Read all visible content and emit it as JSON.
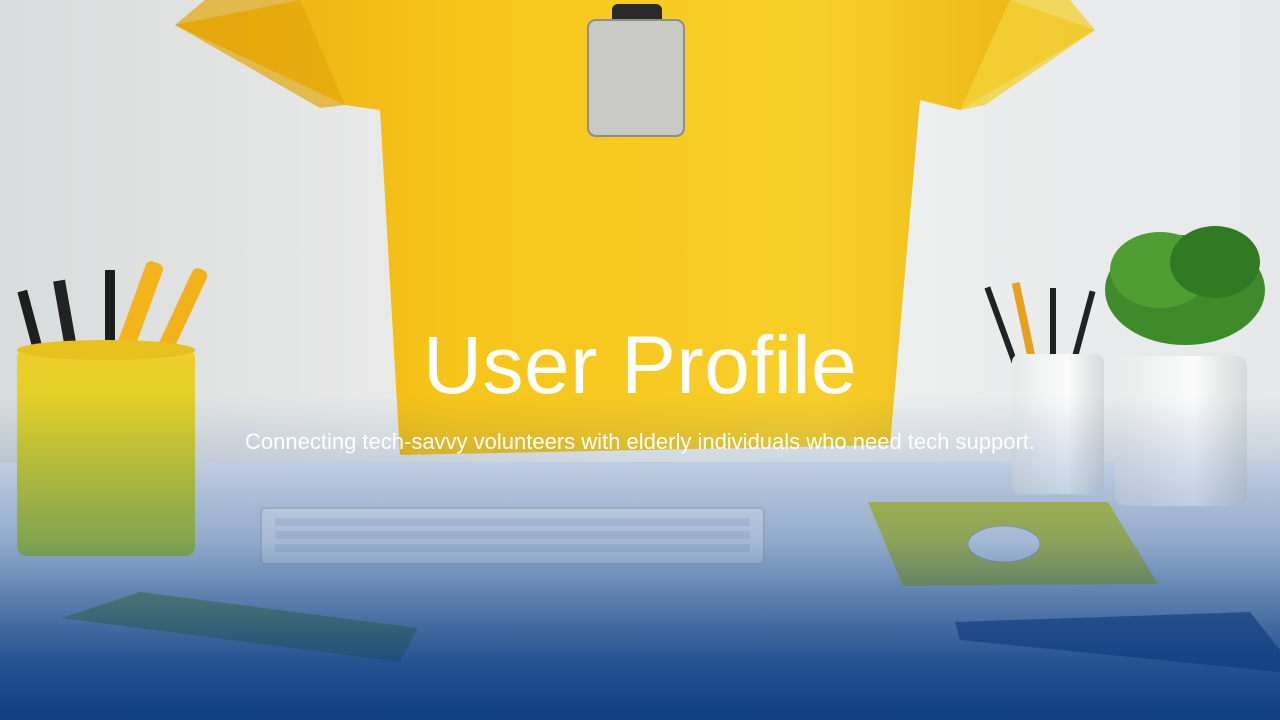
{
  "hero": {
    "title": "User Profile",
    "subtitle": "Connecting tech-savvy volunteers with elderly individuals who need tech support."
  },
  "background_image": {
    "subject": "desk-scene-with-yellow-tshirt",
    "icons": [
      "tshirt-icon",
      "id-badge-icon",
      "pencil-cup-icon",
      "keyboard-icon",
      "mouse-pad-icon",
      "mouse-icon",
      "notebook-icon",
      "plant-icon"
    ]
  },
  "colors": {
    "overlay_bottom": "#06377d",
    "shirt": "#f5c518",
    "text": "#ffffff"
  }
}
